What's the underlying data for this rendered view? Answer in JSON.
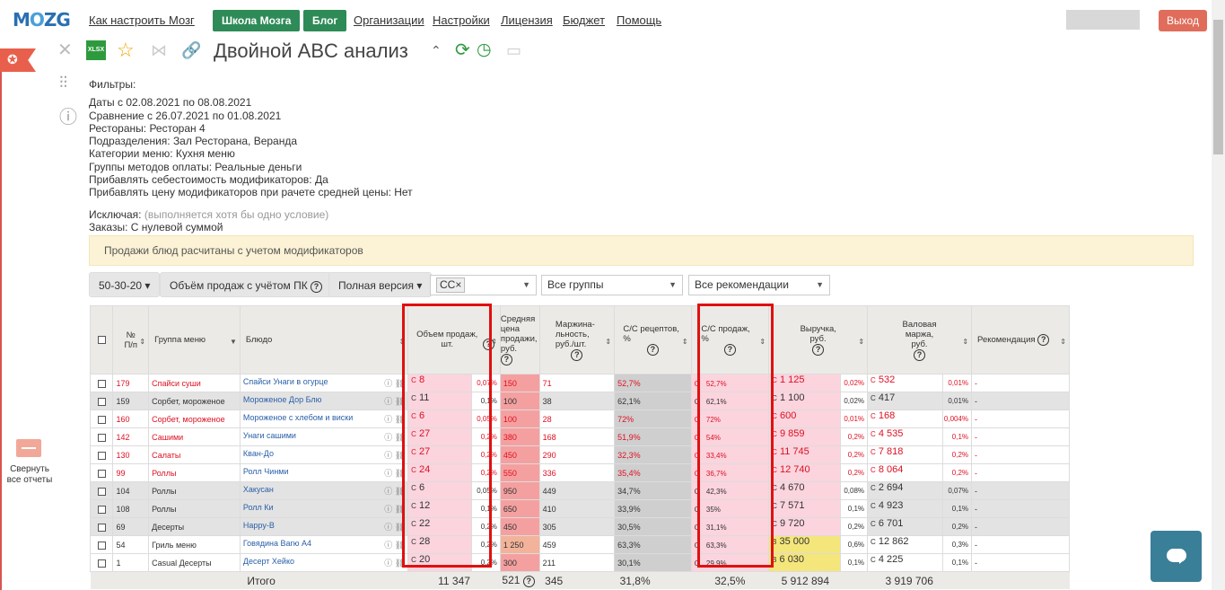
{
  "nav": {
    "logo": "MOZG",
    "links": [
      "Как настроить Мозг",
      "Организации",
      "Настройки",
      "Лицензия",
      "Бюджет",
      "Помощь"
    ],
    "school_btn": "Школа Мозга",
    "blog_btn": "Блог",
    "logout": "Выход"
  },
  "header": {
    "title": "Двойной ABC анализ",
    "xlsx": "XLSX"
  },
  "sidebar": {
    "collapse_label": "Свернуть все отчеты"
  },
  "filters": {
    "heading": "Фильтры:",
    "lines": [
      "Даты с 02.08.2021 по 08.08.2021",
      "Сравнение с 26.07.2021 по 01.08.2021",
      "Рестораны: Ресторан 4",
      "Подразделения: Зал Ресторана, Веранда",
      "Категории меню: Кухня меню",
      "Группы методов оплаты: Реальные деньги",
      "Прибавлять себестоимость модификаторов: Да",
      "Прибавлять цену модификаторов при рачете средней цены: Нет"
    ],
    "exclude_label": "Исключая:",
    "exclude_hint": "(выполняется хотя бы одно условие)",
    "orders": "Заказы: С нулевой суммой"
  },
  "notice": "Продажи блюд расчитаны с учетом модификаторов",
  "toolbar": {
    "ratio": "50-30-20",
    "metric": "Объём продаж с учётом ПК",
    "version": "Полная версия",
    "chip": "СС",
    "groups": "Все группы",
    "recs": "Все рекомендации"
  },
  "columns": {
    "num": "№ П/п",
    "group": "Группа меню",
    "dish": "Блюдо",
    "qty": "Объем продаж, шт.",
    "price": "Средняя цена продажи, руб.",
    "margin": "Маржина-льность, руб./шт.",
    "cs_rec": "С/С рецептов, %",
    "cs_sales": "С/С продаж, %",
    "revenue": "Выручка, руб.",
    "gross": "Валовая маржа, руб.",
    "rec": "Рекомендация"
  },
  "rows": [
    {
      "n": "179",
      "g": "Спайси суши",
      "d": "Спайси Унаги в огурце",
      "qc": "С",
      "q": "8",
      "qp": "0,07%",
      "p": "150",
      "m": "71",
      "csr": "52,7%",
      "csc": "С",
      "cs": "52,7%",
      "rc": "С",
      "r": "1 125",
      "rp": "0,02%",
      "gc": "С",
      "gm": "532",
      "gp": "0,01%",
      "rec": "-"
    },
    {
      "n": "159",
      "g": "Сорбет, мороженое",
      "d": "Мороженое Дор Блю",
      "qc": "С",
      "q": "11",
      "qp": "0,1%",
      "p": "100",
      "m": "38",
      "csr": "62,1%",
      "csc": "С",
      "cs": "62,1%",
      "rc": "С",
      "r": "1 100",
      "rp": "0,02%",
      "gc": "С",
      "gm": "417",
      "gp": "0,01%",
      "rec": "-"
    },
    {
      "n": "160",
      "g": "Сорбет, мороженое",
      "d": "Мороженое с хлебом и виски",
      "qc": "С",
      "q": "6",
      "qp": "0,05%",
      "p": "100",
      "m": "28",
      "csr": "72%",
      "csc": "С",
      "cs": "72%",
      "rc": "С",
      "r": "600",
      "rp": "0,01%",
      "gc": "С",
      "gm": "168",
      "gp": "0,004%",
      "rec": "-"
    },
    {
      "n": "142",
      "g": "Сашими",
      "d": "Унаги сашими",
      "qc": "С",
      "q": "27",
      "qp": "0,2%",
      "p": "380",
      "m": "168",
      "csr": "51,9%",
      "csc": "С",
      "cs": "54%",
      "rc": "С",
      "r": "9 859",
      "rp": "0,2%",
      "gc": "С",
      "gm": "4 535",
      "gp": "0,1%",
      "rec": "-"
    },
    {
      "n": "130",
      "g": "Салаты",
      "d": "Кван-До",
      "qc": "С",
      "q": "27",
      "qp": "0,2%",
      "p": "450",
      "m": "290",
      "csr": "32,3%",
      "csc": "С",
      "cs": "33,4%",
      "rc": "С",
      "r": "11 745",
      "rp": "0,2%",
      "gc": "С",
      "gm": "7 818",
      "gp": "0,2%",
      "rec": "-"
    },
    {
      "n": "99",
      "g": "Роллы",
      "d": "Ролл Чинми",
      "qc": "С",
      "q": "24",
      "qp": "0,2%",
      "p": "550",
      "m": "336",
      "csr": "35,4%",
      "csc": "С",
      "cs": "36,7%",
      "rc": "С",
      "r": "12 740",
      "rp": "0,2%",
      "gc": "С",
      "gm": "8 064",
      "gp": "0,2%",
      "rec": "-"
    },
    {
      "n": "104",
      "g": "Роллы",
      "d": "Хакусан",
      "qc": "С",
      "q": "6",
      "qp": "0,05%",
      "p": "950",
      "m": "449",
      "csr": "34,7%",
      "csc": "С",
      "cs": "42,3%",
      "rc": "С",
      "r": "4 670",
      "rp": "0,08%",
      "gc": "С",
      "gm": "2 694",
      "gp": "0,07%",
      "rec": "-"
    },
    {
      "n": "108",
      "g": "Роллы",
      "d": "Ролл Ки",
      "qc": "С",
      "q": "12",
      "qp": "0,1%",
      "p": "650",
      "m": "410",
      "csr": "33,9%",
      "csc": "С",
      "cs": "35%",
      "rc": "С",
      "r": "7 571",
      "rp": "0,1%",
      "gc": "С",
      "gm": "4 923",
      "gp": "0,1%",
      "rec": "-"
    },
    {
      "n": "69",
      "g": "Десерты",
      "d": "Happy-B",
      "qc": "С",
      "q": "22",
      "qp": "0,2%",
      "p": "450",
      "m": "305",
      "csr": "30,5%",
      "csc": "С",
      "cs": "31,1%",
      "rc": "С",
      "r": "9 720",
      "rp": "0,2%",
      "gc": "С",
      "gm": "6 701",
      "gp": "0,2%",
      "rec": "-"
    },
    {
      "n": "54",
      "g": "Гриль меню",
      "d": "Говядина Вагю А4",
      "qc": "С",
      "q": "28",
      "qp": "0,2%",
      "p": "1 250",
      "m": "459",
      "csr": "63,3%",
      "csc": "С",
      "cs": "63,3%",
      "rc": "B",
      "r": "35 000",
      "rp": "0,6%",
      "gc": "С",
      "gm": "12 862",
      "gp": "0,3%",
      "rec": "-"
    },
    {
      "n": "1",
      "g": "Casual Десерты",
      "d": "Десерт Хейко",
      "qc": "С",
      "q": "20",
      "qp": "0,2%",
      "p": "300",
      "m": "211",
      "csr": "30,1%",
      "csc": "С",
      "cs": "29,9%",
      "rc": "B",
      "r": "6 030",
      "rp": "0,1%",
      "gc": "С",
      "gm": "4 225",
      "gp": "0,1%",
      "rec": "-"
    }
  ],
  "total": {
    "label": "Итого",
    "qty": "11 347",
    "price": "521",
    "margin": "345",
    "cs_rec": "31,8%",
    "cs_sales": "32,5%",
    "revenue": "5 912 894",
    "gross": "3 919 706"
  }
}
